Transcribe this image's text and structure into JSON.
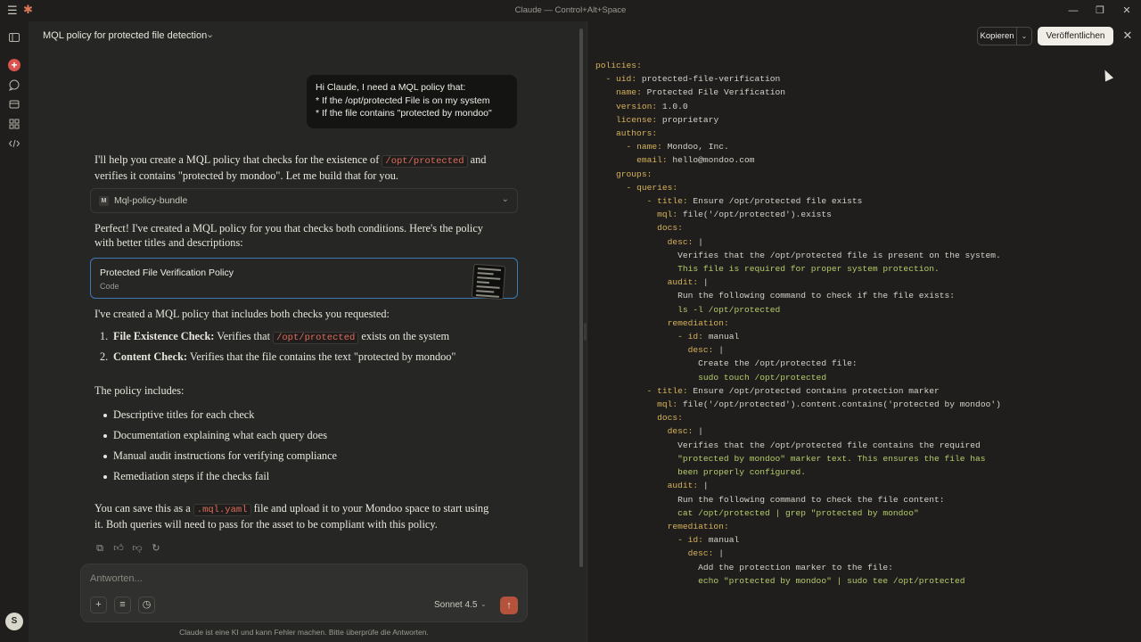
{
  "window": {
    "title": "Claude — Control+Alt+Space",
    "icons": [
      "menu-icon",
      "claude-logo-icon",
      "minimize-icon",
      "maximize-icon",
      "close-icon"
    ]
  },
  "rail": {
    "icons": [
      "sidebar-toggle-icon",
      "new-chat-icon",
      "chats-icon",
      "projects-icon",
      "artifacts-icon",
      "code-icon"
    ],
    "avatar_initial": "S",
    "accent": "#d9534f"
  },
  "conversation": {
    "title": "MQL policy for protected file detection",
    "user_message": {
      "line1": "Hi Claude, I need a MQL policy that:",
      "line2": "* If the /opt/protected File is on my system",
      "line3": "* If the file contains \"protected by mondoo\""
    },
    "intro": {
      "text_a": "I'll help you create a MQL policy that checks for the existence of ",
      "code": "/opt/protected",
      "text_b": " and verifies it contains \"protected by mondoo\". Let me build that for you."
    },
    "tool_card": {
      "badge": "M",
      "label": "Mql-policy-bundle"
    },
    "followup": "Perfect! I've created a MQL policy for you that checks both conditions. Here's the policy with better titles and descriptions:",
    "artifact": {
      "title": "Protected File Verification Policy",
      "subtitle": "Code",
      "border_color": "#3d7ab5"
    },
    "includes_intro": "I've created a MQL policy that includes both checks you requested:",
    "steps": [
      {
        "num": "1.",
        "bold": "File Existence Check:",
        "text_a": " Verifies that ",
        "code": "/opt/protected",
        "text_b": " exists on the system"
      },
      {
        "num": "2.",
        "bold": "Content Check:",
        "text_a": " Verifies that the file contains the text \"protected by mondoo\"",
        "code": "",
        "text_b": ""
      }
    ],
    "policy_includes": "The policy includes:",
    "bullets": [
      "Descriptive titles for each check",
      "Documentation explaining what each query does",
      "Manual audit instructions for verifying compliance",
      "Remediation steps if the checks fail"
    ],
    "closing": {
      "text_a": "You can save this as a ",
      "code": ".mql.yaml",
      "text_b": " file and upload it to your Mondoo space to start using it. Both queries will need to pass for the asset to be compliant with this policy."
    },
    "message_actions": [
      "copy-icon",
      "thumbs-up-icon",
      "thumbs-down-icon",
      "retry-icon"
    ]
  },
  "composer": {
    "placeholder": "Antworten...",
    "buttons": [
      "plus-icon",
      "tools-icon",
      "history-icon"
    ],
    "model": "Sonnet 4.5",
    "send_color": "#b5523b"
  },
  "disclaimer": "Claude ist eine KI und kann Fehler machen. Bitte überprüfe die Antworten.",
  "panel": {
    "copy_label": "Kopieren",
    "publish_label": "Veröffentlichen",
    "code_lines": [
      "policies:",
      "  - uid: protected-file-verification",
      "    name: Protected File Verification",
      "    version: 1.0.0",
      "    license: proprietary",
      "    authors:",
      "      - name: Mondoo, Inc.",
      "        email: hello@mondoo.com",
      "    groups:",
      "      - queries:",
      "          - title: Ensure /opt/protected file exists",
      "            mql: file('/opt/protected').exists",
      "            docs:",
      "              desc: |",
      "                Verifies that the /opt/protected file is present on the system.",
      "                This file is required for proper system protection.",
      "              audit: |",
      "                Run the following command to check if the file exists:",
      "                ls -l /opt/protected",
      "              remediation:",
      "                - id: manual",
      "                  desc: |",
      "                    Create the /opt/protected file:",
      "                    sudo touch /opt/protected",
      "          - title: Ensure /opt/protected contains protection marker",
      "            mql: file('/opt/protected').content.contains('protected by mondoo')",
      "            docs:",
      "              desc: |",
      "                Verifies that the /opt/protected file contains the required",
      "                \"protected by mondoo\" marker text. This ensures the file has",
      "                been properly configured.",
      "              audit: |",
      "                Run the following command to check the file content:",
      "                cat /opt/protected | grep \"protected by mondoo\"",
      "              remediation:",
      "                - id: manual",
      "                  desc: |",
      "                    Add the protection marker to the file:",
      "                    echo \"protected by mondoo\" | sudo tee /opt/protected"
    ],
    "key_color": "#d6b25a",
    "string_color": "#b5cc6a"
  }
}
